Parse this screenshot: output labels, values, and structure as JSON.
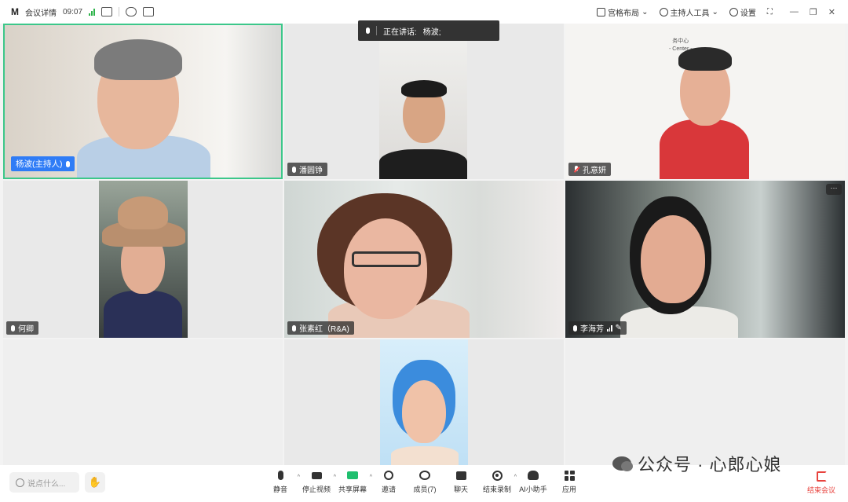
{
  "topbar": {
    "app_name": "会议详情",
    "time": "09:07",
    "layout_label": "宫格布局",
    "host_tools_label": "主持人工具",
    "settings_label": "设置"
  },
  "speaking_now": {
    "label": "正在讲话:",
    "name": "杨波;"
  },
  "participants": [
    {
      "name": "杨波(主持人)",
      "mic": "on",
      "role": "host"
    },
    {
      "name": "潘圆铮",
      "mic": "on"
    },
    {
      "name": "孔意妍",
      "mic": "muted",
      "logo_text": "务中心",
      "logo_sub": "- Center -"
    },
    {
      "name": "何卿",
      "mic": "on"
    },
    {
      "name": "张素红（R&A)",
      "mic": "on"
    },
    {
      "name": "李海芳",
      "mic": "on"
    },
    {
      "name": "",
      "mic": ""
    }
  ],
  "more_button": "···",
  "bottombar": {
    "chat_placeholder": "说点什么...",
    "tools": [
      {
        "label": "静音",
        "icon": "mic-icon"
      },
      {
        "label": "停止视频",
        "icon": "camera-icon"
      },
      {
        "label": "共享屏幕",
        "icon": "share-screen-icon"
      },
      {
        "label": "邀请",
        "icon": "invite-icon"
      },
      {
        "label": "成员(7)",
        "icon": "members-icon"
      },
      {
        "label": "聊天",
        "icon": "chat-icon"
      },
      {
        "label": "结束录制",
        "icon": "record-icon"
      },
      {
        "label": "AI小助手",
        "icon": "ai-assistant-icon"
      },
      {
        "label": "应用",
        "icon": "apps-icon"
      }
    ],
    "end_label": "结束会议"
  },
  "watermark": "公众号 · 心郎心娘",
  "colors": {
    "host_tag": "#2f7cf6",
    "active_border": "#3cc78a",
    "share_green": "#1fbf6e",
    "end_red": "#e8433e"
  }
}
